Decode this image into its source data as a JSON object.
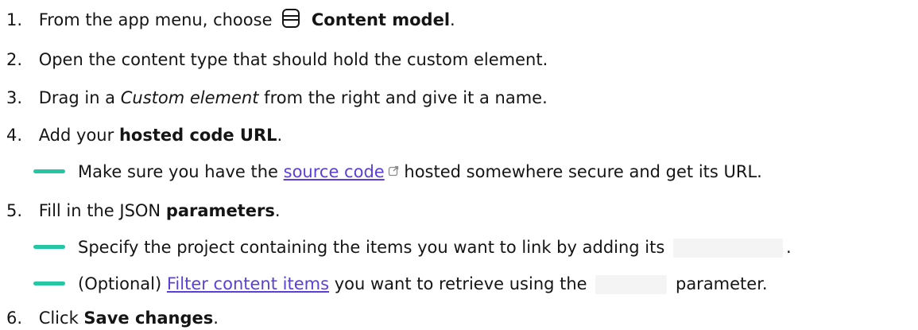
{
  "steps": [
    {
      "num": "1.",
      "pre": "From the app menu, choose",
      "bold": "Content model",
      "post": ".",
      "icon": "content-model-icon"
    },
    {
      "num": "2.",
      "text": "Open the content type that should hold the custom element."
    },
    {
      "num": "3.",
      "pre": "Drag in a",
      "italic": "Custom element",
      "post": "from the right and give it a name."
    },
    {
      "num": "4.",
      "pre": "Add your",
      "bold": "hosted code URL",
      "post": "."
    },
    {
      "num": "5.",
      "pre": "Fill in the JSON",
      "bold": "parameters",
      "post": "."
    },
    {
      "num": "6.",
      "pre": "Click",
      "bold": "Save changes",
      "post": "."
    }
  ],
  "subs": {
    "s4a": {
      "pre": "Make sure you have the",
      "link": "source code",
      "post": "hosted somewhere secure and get its URL.",
      "icon": "external-link-icon"
    },
    "s5a": {
      "pre": "Specify the project containing the items you want to link by adding its",
      "post": "."
    },
    "s5b": {
      "pre": "(Optional)",
      "link": "Filter content items",
      "post": "you want to retrieve using the",
      "post2": "parameter."
    }
  },
  "colors": {
    "accent_dash": "#26c6a5",
    "link": "#5b3fdb",
    "code_bg": "#f4f4f5"
  }
}
